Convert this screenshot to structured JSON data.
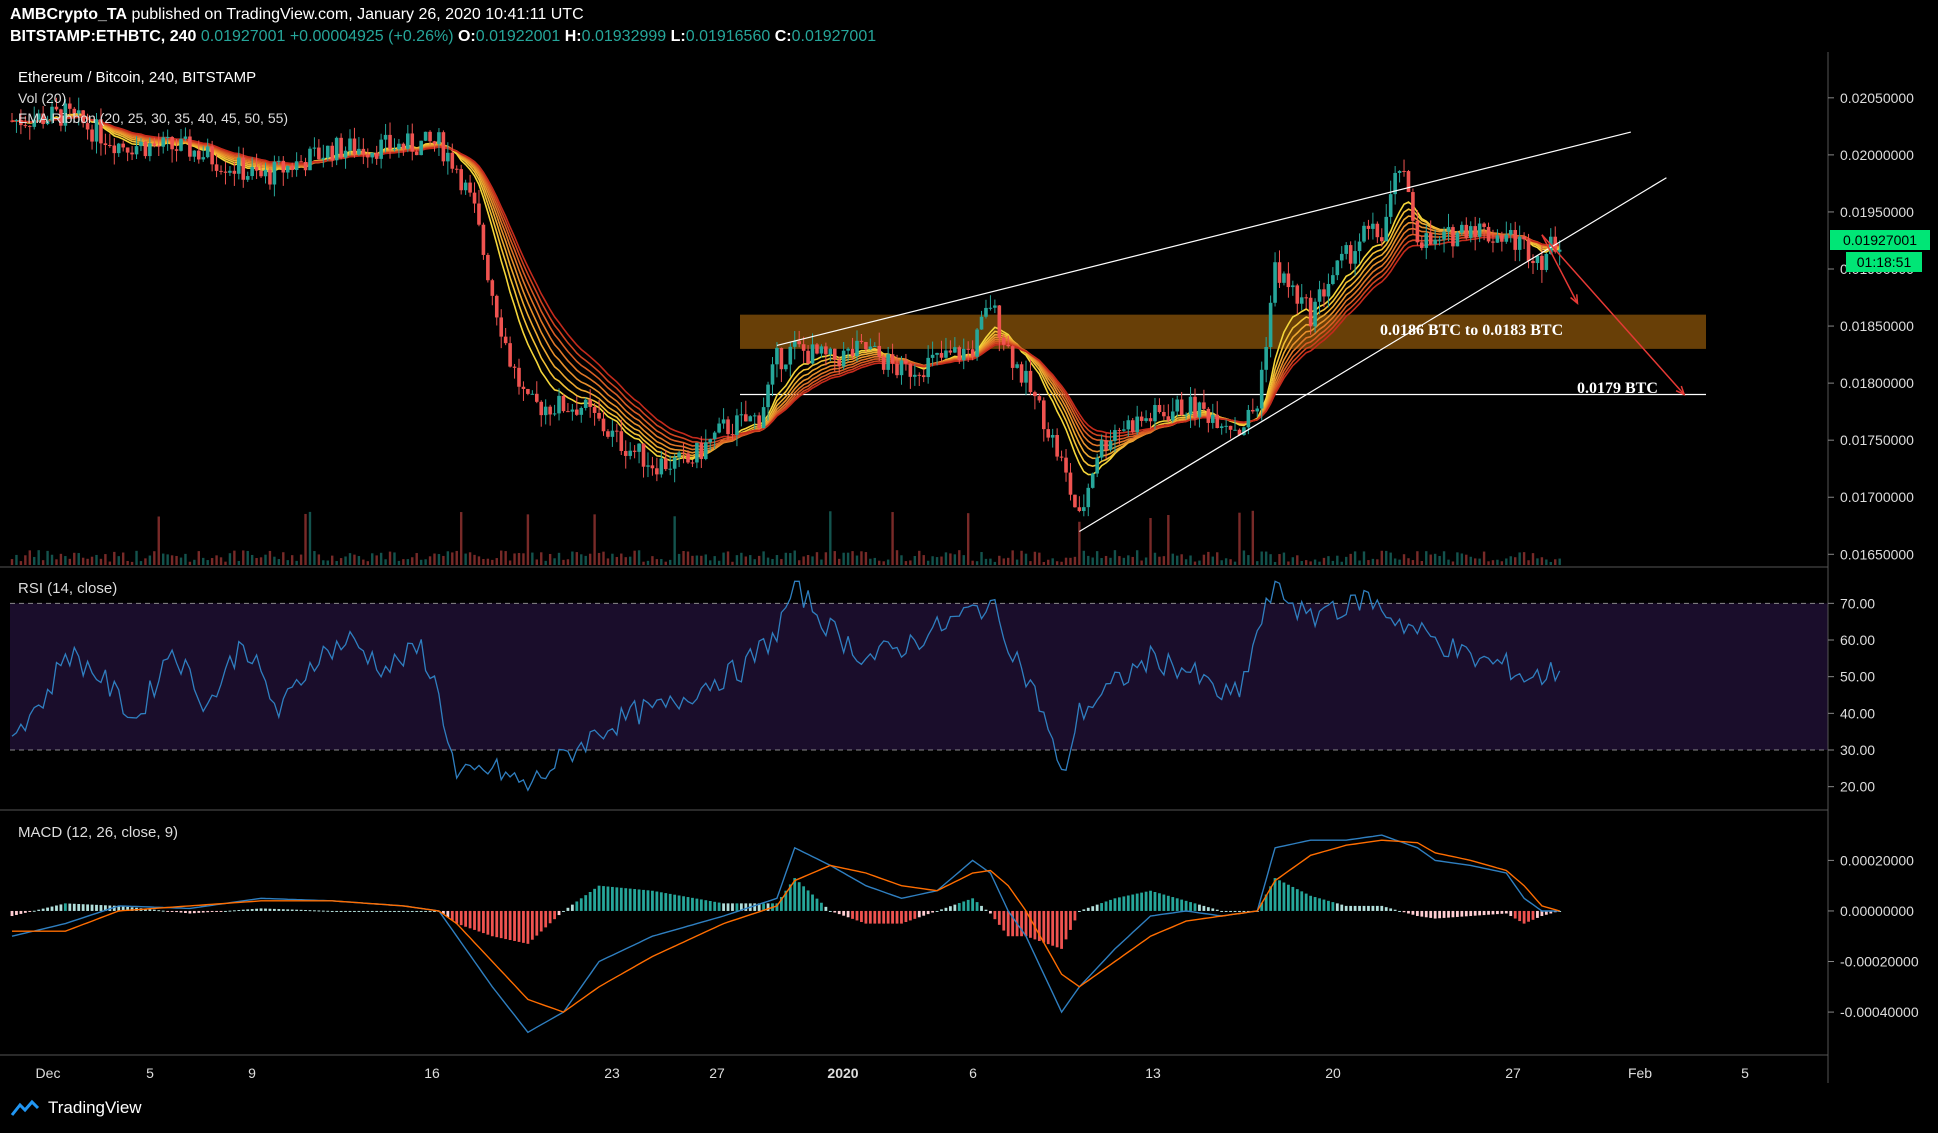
{
  "header": {
    "publisher": "AMBCrypto_TA",
    "published_text": "published on TradingView.com, January 26, 2020 10:41:11 UTC",
    "symbol": "BITSTAMP:ETHBTC, 240",
    "last": "0.01927001",
    "change": "+0.00004925 (+0.26%)",
    "o_label": "O:",
    "o": "0.01922001",
    "h_label": "H:",
    "h": "0.01932999",
    "l_label": "L:",
    "l": "0.01916560",
    "c_label": "C:",
    "c": "0.01927001"
  },
  "panes": {
    "price_title": "Ethereum / Bitcoin, 240, BITSTAMP",
    "vol_label": "Vol (20)",
    "ema_label": "EMA Ribbon (20, 25, 30, 35, 40, 45, 50, 55)",
    "rsi_label": "RSI (14, close)",
    "macd_label": "MACD (12, 26, close, 9)"
  },
  "badges": {
    "price": "0.01927001",
    "timer": "01:18:51"
  },
  "annotations": {
    "zone_label": "0.0186 BTC to 0.0183 BTC",
    "support_label": "0.0179 BTC"
  },
  "footer": {
    "brand": "TradingView"
  },
  "colors": {
    "up": "#26a69a",
    "down": "#ef5350",
    "green_badge": "#00e676",
    "zone": "#7a4a08",
    "rsi_band": "#1a0d2b",
    "rsi_line": "#2f7fc0",
    "macd_line": "#2f7fc0",
    "signal_line": "#ff6d00"
  },
  "chart_data": {
    "type": "candlestick",
    "x_ticks": [
      "Dec",
      "5",
      "9",
      "16",
      "23",
      "27",
      "2020",
      "6",
      "13",
      "20",
      "27",
      "Feb",
      "5"
    ],
    "price": {
      "ylim": [
        0.01645,
        0.0207
      ],
      "y_ticks": [
        "0.02050000",
        "0.02000000",
        "0.01950000",
        "0.01900000",
        "0.01850000",
        "0.01800000",
        "0.01750000",
        "0.01700000",
        "0.01650000"
      ],
      "close_path": [
        [
          0,
          0.0203
        ],
        [
          3,
          0.02035
        ],
        [
          6,
          0.0201
        ],
        [
          10,
          0.02005
        ],
        [
          14,
          0.0198
        ],
        [
          18,
          0.02005
        ],
        [
          22,
          0.02008
        ],
        [
          24,
          0.0201
        ],
        [
          25,
          0.0199
        ],
        [
          26,
          0.0195
        ],
        [
          27,
          0.0188
        ],
        [
          28,
          0.0182
        ],
        [
          29,
          0.0178
        ],
        [
          30,
          0.0178
        ],
        [
          32,
          0.0178
        ],
        [
          34,
          0.0175
        ],
        [
          36,
          0.0173
        ],
        [
          38,
          0.0173
        ],
        [
          40,
          0.0176
        ],
        [
          42,
          0.0177
        ],
        [
          43,
          0.0182
        ],
        [
          44,
          0.0183
        ],
        [
          46,
          0.0182
        ],
        [
          48,
          0.0183
        ],
        [
          50,
          0.0181
        ],
        [
          52,
          0.0182
        ],
        [
          54,
          0.0183
        ],
        [
          55,
          0.0187
        ],
        [
          56,
          0.0183
        ],
        [
          57,
          0.018
        ],
        [
          58,
          0.0177
        ],
        [
          59,
          0.0173
        ],
        [
          60,
          0.0168
        ],
        [
          61,
          0.0174
        ],
        [
          62,
          0.0176
        ],
        [
          64,
          0.0177
        ],
        [
          66,
          0.0178
        ],
        [
          68,
          0.0177
        ],
        [
          69,
          0.0176
        ],
        [
          70,
          0.0178
        ],
        [
          71,
          0.019
        ],
        [
          72,
          0.0188
        ],
        [
          73,
          0.0186
        ],
        [
          74,
          0.0189
        ],
        [
          75,
          0.0191
        ],
        [
          76,
          0.0193
        ],
        [
          77,
          0.0193
        ],
        [
          78,
          0.0199
        ],
        [
          79,
          0.0193
        ],
        [
          80,
          0.0192
        ],
        [
          81,
          0.0193
        ],
        [
          82,
          0.0194
        ],
        [
          83,
          0.0193
        ],
        [
          84,
          0.0193
        ],
        [
          85,
          0.0192
        ],
        [
          86,
          0.0191
        ],
        [
          87,
          0.01927
        ]
      ],
      "zone": [
        0.0183,
        0.0186
      ],
      "support": 0.0179,
      "rising_wedge_upper": [
        [
          43,
          0.01833
        ],
        [
          91,
          0.0202
        ]
      ],
      "rising_wedge_lower": [
        [
          60,
          0.0167
        ],
        [
          93,
          0.0198
        ]
      ],
      "projection_arrows": [
        [
          [
            86,
            0.0193
          ],
          [
            88,
            0.0187
          ]
        ],
        [
          [
            86,
            0.0193
          ],
          [
            94,
            0.0179
          ]
        ]
      ]
    },
    "rsi": {
      "ylim": [
        15,
        75
      ],
      "y_ticks": [
        "70.00",
        "60.00",
        "50.00",
        "40.00",
        "30.00",
        "20.00"
      ],
      "band": [
        30,
        70
      ],
      "values": [
        [
          0,
          35
        ],
        [
          2,
          45
        ],
        [
          3,
          57
        ],
        [
          5,
          50
        ],
        [
          7,
          38
        ],
        [
          9,
          58
        ],
        [
          11,
          42
        ],
        [
          13,
          60
        ],
        [
          15,
          40
        ],
        [
          17,
          55
        ],
        [
          19,
          60
        ],
        [
          21,
          52
        ],
        [
          23,
          58
        ],
        [
          24,
          45
        ],
        [
          25,
          22
        ],
        [
          27,
          25
        ],
        [
          29,
          20
        ],
        [
          31,
          28
        ],
        [
          33,
          35
        ],
        [
          35,
          40
        ],
        [
          37,
          42
        ],
        [
          39,
          48
        ],
        [
          41,
          52
        ],
        [
          43,
          62
        ],
        [
          44,
          75
        ],
        [
          46,
          63
        ],
        [
          48,
          55
        ],
        [
          50,
          58
        ],
        [
          52,
          63
        ],
        [
          54,
          68
        ],
        [
          55,
          70
        ],
        [
          56,
          60
        ],
        [
          58,
          40
        ],
        [
          59,
          22
        ],
        [
          60,
          40
        ],
        [
          62,
          48
        ],
        [
          64,
          55
        ],
        [
          66,
          52
        ],
        [
          68,
          45
        ],
        [
          69,
          45
        ],
        [
          70,
          62
        ],
        [
          71,
          75
        ],
        [
          72,
          70
        ],
        [
          73,
          65
        ],
        [
          74,
          70
        ],
        [
          75,
          68
        ],
        [
          76,
          72
        ],
        [
          78,
          65
        ],
        [
          80,
          60
        ],
        [
          82,
          55
        ],
        [
          84,
          53
        ],
        [
          85,
          50
        ],
        [
          86,
          50
        ],
        [
          87,
          52
        ]
      ]
    },
    "macd": {
      "ylim": [
        -0.00055,
        0.00034
      ],
      "y_ticks": [
        "0.00020000",
        "0.00000000",
        "-0.00020000",
        "-0.00040000"
      ],
      "macd": [
        [
          0,
          -0.0001
        ],
        [
          3,
          -5e-05
        ],
        [
          6,
          2e-05
        ],
        [
          10,
          1e-05
        ],
        [
          14,
          5e-05
        ],
        [
          18,
          4e-05
        ],
        [
          22,
          2e-05
        ],
        [
          24,
          0.0
        ],
        [
          25,
          -0.0001
        ],
        [
          27,
          -0.0003
        ],
        [
          29,
          -0.00048
        ],
        [
          31,
          -0.0004
        ],
        [
          33,
          -0.0002
        ],
        [
          36,
          -0.0001
        ],
        [
          40,
          -2e-05
        ],
        [
          43,
          5e-05
        ],
        [
          44,
          0.00025
        ],
        [
          46,
          0.00018
        ],
        [
          48,
          0.0001
        ],
        [
          50,
          5e-05
        ],
        [
          52,
          8e-05
        ],
        [
          54,
          0.0002
        ],
        [
          55,
          0.00015
        ],
        [
          56,
          0.0
        ],
        [
          57,
          -0.0001
        ],
        [
          59,
          -0.0004
        ],
        [
          60,
          -0.0003
        ],
        [
          62,
          -0.00015
        ],
        [
          64,
          -2e-05
        ],
        [
          66,
          0.0
        ],
        [
          68,
          -2e-05
        ],
        [
          70,
          0.0
        ],
        [
          71,
          0.00025
        ],
        [
          73,
          0.00028
        ],
        [
          75,
          0.00028
        ],
        [
          77,
          0.0003
        ],
        [
          79,
          0.00025
        ],
        [
          80,
          0.0002
        ],
        [
          82,
          0.00018
        ],
        [
          84,
          0.00015
        ],
        [
          85,
          5e-05
        ],
        [
          86,
          0.0
        ],
        [
          87,
          0.0
        ]
      ],
      "signal": [
        [
          0,
          -8e-05
        ],
        [
          3,
          -8e-05
        ],
        [
          6,
          0.0
        ],
        [
          10,
          2e-05
        ],
        [
          14,
          4e-05
        ],
        [
          18,
          4e-05
        ],
        [
          22,
          2e-05
        ],
        [
          24,
          0.0
        ],
        [
          25,
          -5e-05
        ],
        [
          27,
          -0.0002
        ],
        [
          29,
          -0.00035
        ],
        [
          31,
          -0.0004
        ],
        [
          33,
          -0.0003
        ],
        [
          36,
          -0.00018
        ],
        [
          40,
          -5e-05
        ],
        [
          43,
          2e-05
        ],
        [
          44,
          0.00012
        ],
        [
          46,
          0.00018
        ],
        [
          48,
          0.00015
        ],
        [
          50,
          0.0001
        ],
        [
          52,
          8e-05
        ],
        [
          54,
          0.00015
        ],
        [
          55,
          0.00016
        ],
        [
          56,
          0.0001
        ],
        [
          57,
          0.0
        ],
        [
          59,
          -0.00025
        ],
        [
          60,
          -0.0003
        ],
        [
          62,
          -0.0002
        ],
        [
          64,
          -0.0001
        ],
        [
          66,
          -4e-05
        ],
        [
          68,
          -2e-05
        ],
        [
          70,
          0.0
        ],
        [
          71,
          0.00012
        ],
        [
          73,
          0.00022
        ],
        [
          75,
          0.00026
        ],
        [
          77,
          0.00028
        ],
        [
          79,
          0.00027
        ],
        [
          80,
          0.00023
        ],
        [
          82,
          0.0002
        ],
        [
          84,
          0.00016
        ],
        [
          85,
          0.0001
        ],
        [
          86,
          2e-05
        ],
        [
          87,
          0.0
        ]
      ]
    }
  }
}
